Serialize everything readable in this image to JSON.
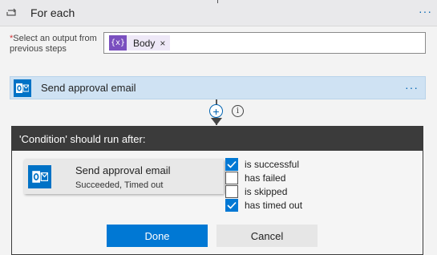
{
  "foreach": {
    "title": "For each",
    "more": "···"
  },
  "select_output": {
    "required_mark": "*",
    "label": "Select an output from previous steps",
    "token_icon": "{x}",
    "token_label": "Body",
    "token_remove": "×"
  },
  "action": {
    "title": "Send approval email",
    "more": "···",
    "icon": "outlook-icon"
  },
  "connector": {
    "plus": "+",
    "info": "i"
  },
  "dialog": {
    "header": "'Condition' should run after:",
    "card": {
      "title": "Send approval email",
      "subtitle": "Succeeded, Timed out"
    },
    "options": [
      {
        "label": "is successful",
        "checked": true
      },
      {
        "label": "has failed",
        "checked": false
      },
      {
        "label": "is skipped",
        "checked": false
      },
      {
        "label": "has timed out",
        "checked": true
      }
    ],
    "done_label": "Done",
    "cancel_label": "Cancel"
  },
  "colors": {
    "accent": "#0078d4",
    "action_bg": "#cfe2f3",
    "dialog_header": "#3b3b3b",
    "outlook": "#0072c6",
    "token": "#7a4fbf"
  }
}
